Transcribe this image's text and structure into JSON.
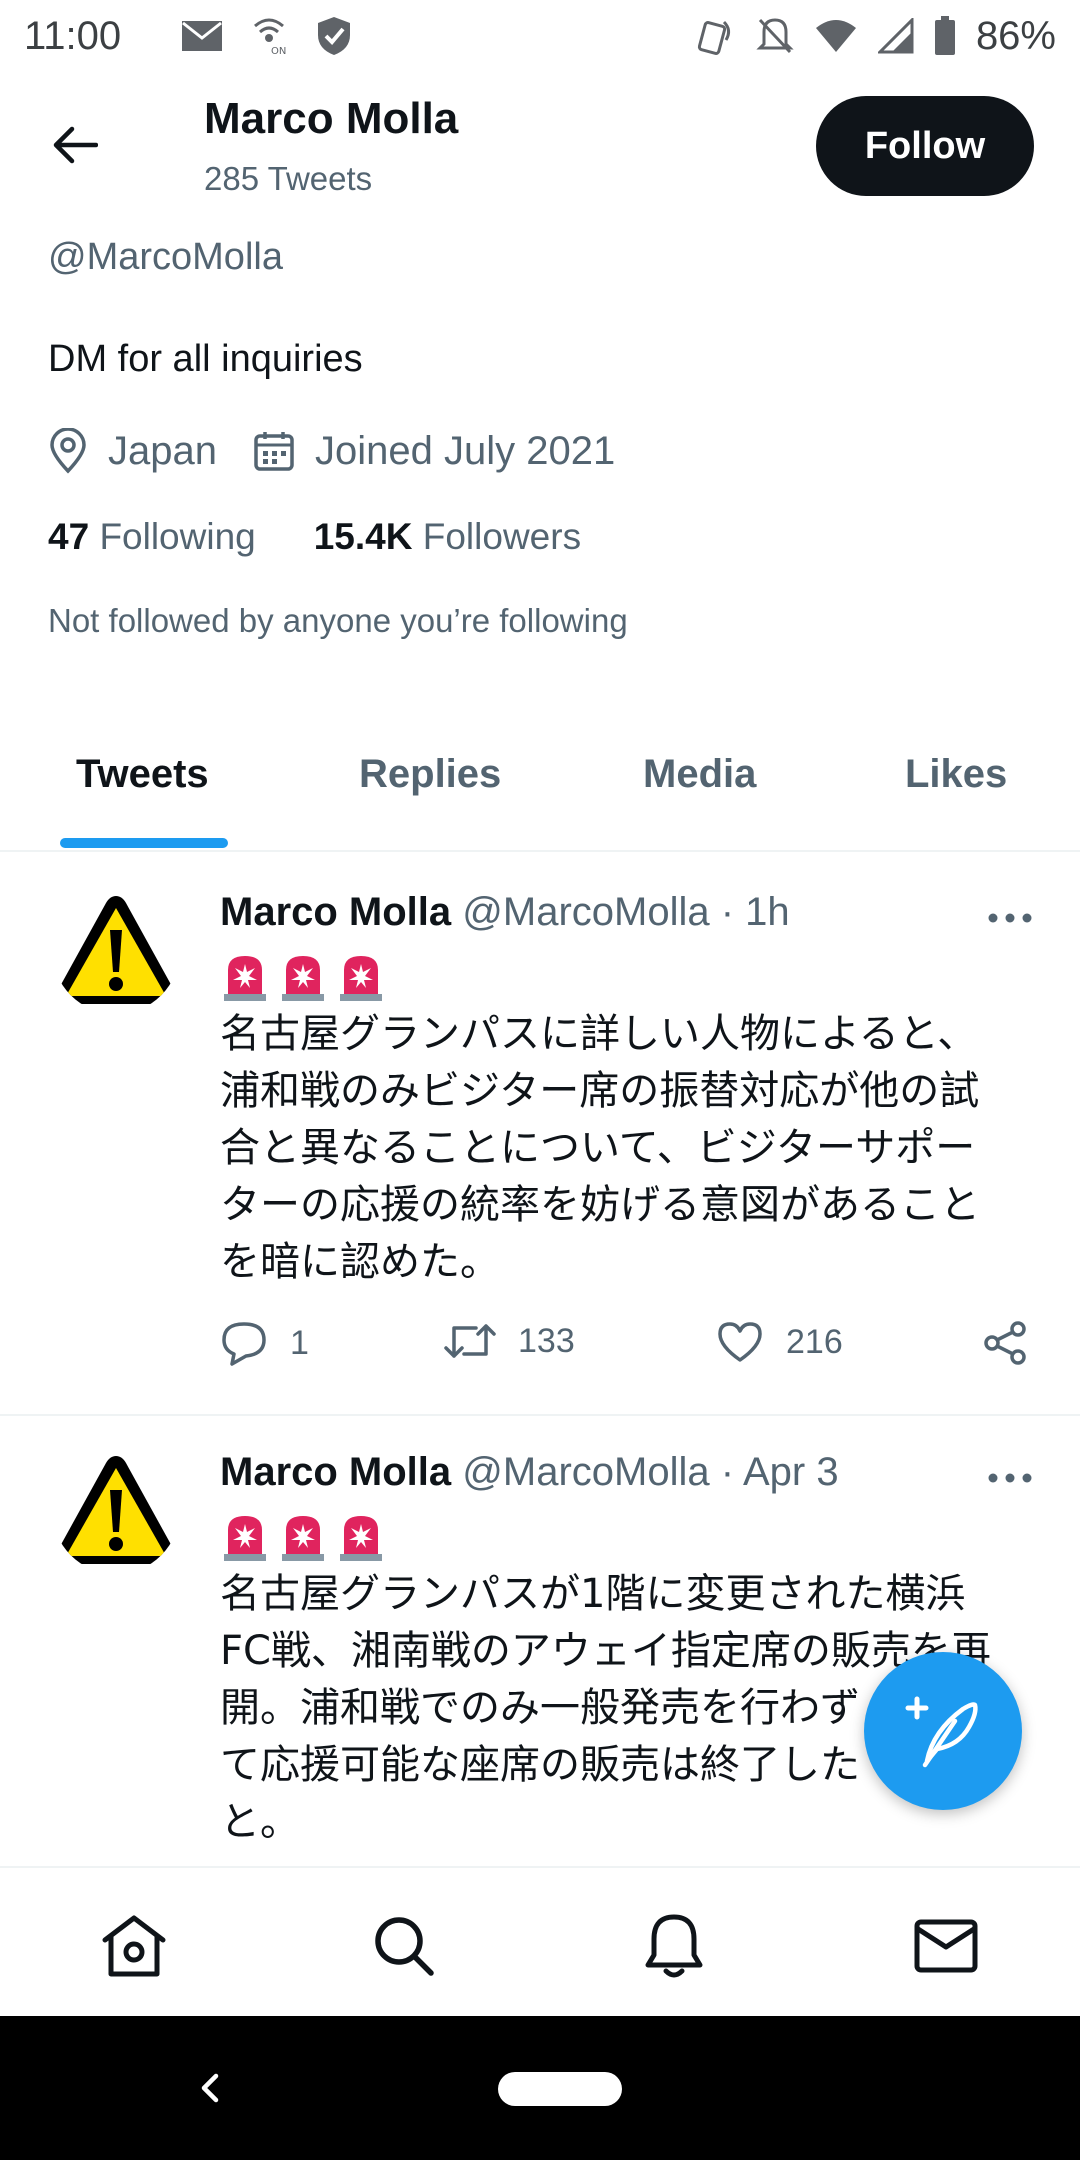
{
  "status_bar": {
    "time": "11:00",
    "battery": "86%",
    "icons": [
      "mail-icon",
      "call-signal-icon",
      "shield-icon",
      "nfc-icon",
      "mute-icon",
      "wifi-icon",
      "cell-signal-icon",
      "battery-icon"
    ]
  },
  "header": {
    "name": "Marco Molla",
    "tweet_count": "285 Tweets",
    "follow_label": "Follow"
  },
  "profile": {
    "handle": "@MarcoMolla",
    "bio": "DM for all inquiries",
    "location": "Japan",
    "joined": "Joined July 2021",
    "following_count": "47",
    "following_label": "Following",
    "followers_count": "15.4K",
    "followers_label": "Followers",
    "not_followed": "Not followed by anyone you’re following"
  },
  "tabs": [
    "Tweets",
    "Replies",
    "Media",
    "Likes"
  ],
  "active_tab": "Tweets",
  "tweets": [
    {
      "name": "Marco Molla",
      "handle": "@MarcoMolla",
      "date": "· 1h",
      "emoji": "🚨🚨🚨",
      "lines": [
        "名古屋グランパスに詳しい人物によると、",
        "浦和戦のみビジター席の振替対応が他の試",
        "合と異なることについて、ビジターサポー",
        "ターの応援の統率を妨げる意図があること",
        "を暗に認めた。"
      ],
      "replies": "1",
      "retweets": "133",
      "likes": "216"
    },
    {
      "name": "Marco Molla",
      "handle": "@MarcoMolla",
      "date": "· Apr 3",
      "emoji": "🚨🚨🚨",
      "lines": [
        "名古屋グランパスが1階に変更された横浜",
        "FC戦、湘南戦のアウェイ指定席の販売を再",
        "開。浦和戦でのみ一般発売を行わず",
        "て応援可能な座席の販売は終了した",
        "と。"
      ]
    }
  ],
  "colors": {
    "accent": "#1d9bf0",
    "text": "#0f1419",
    "secondary": "#536471"
  }
}
